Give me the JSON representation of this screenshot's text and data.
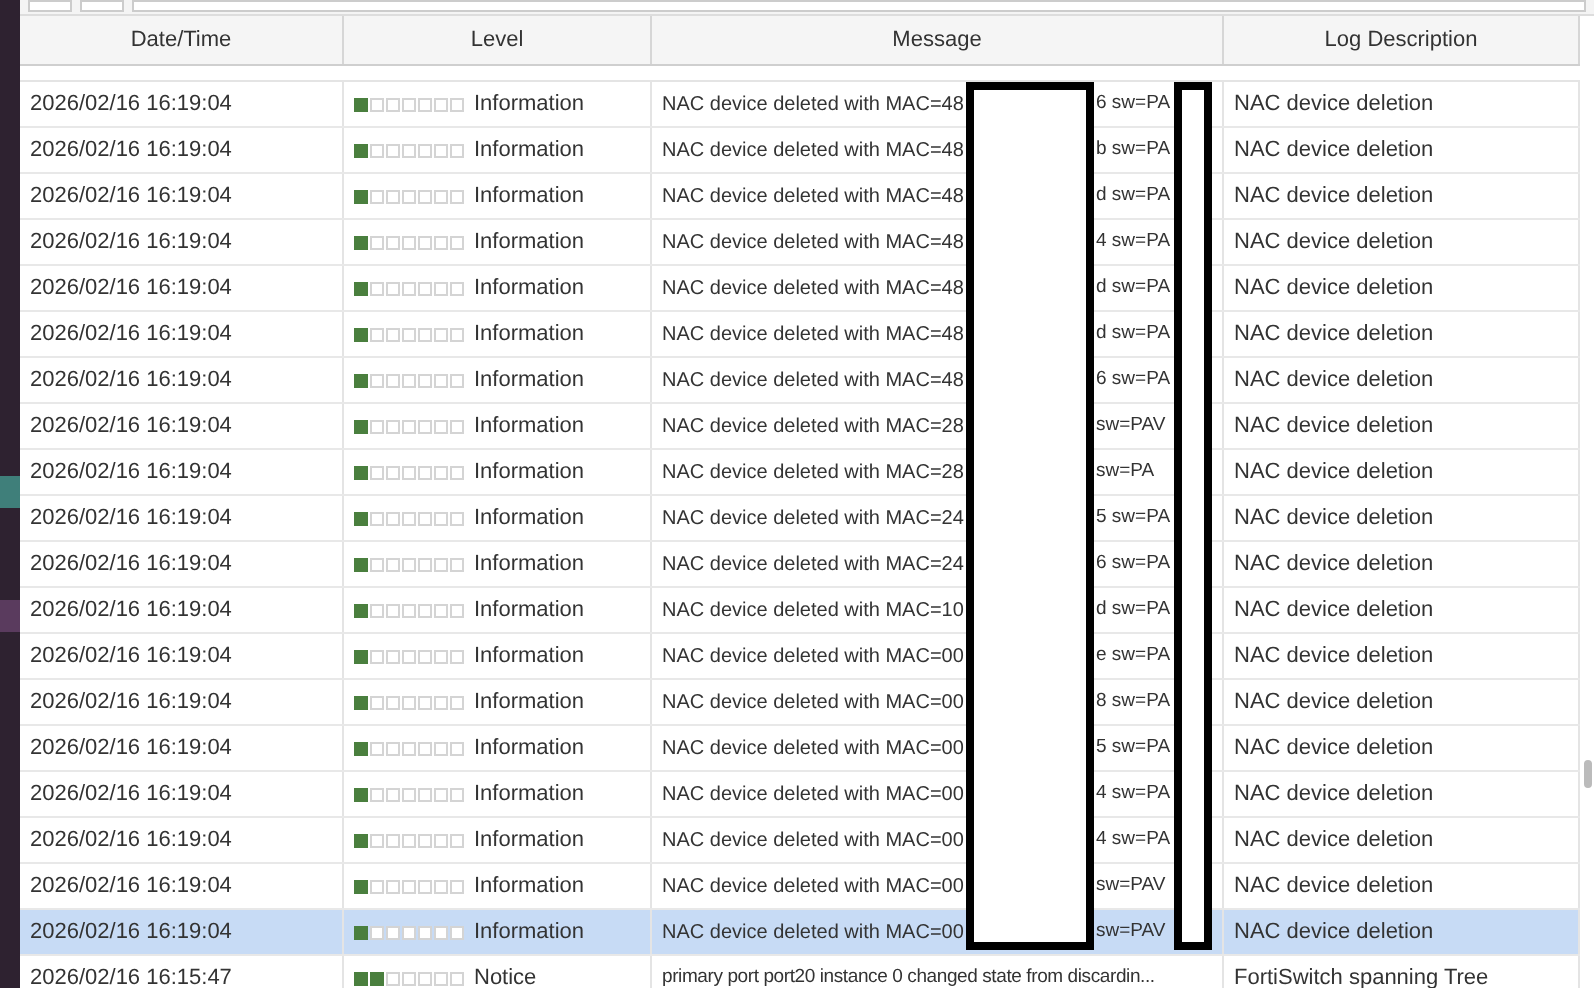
{
  "columns": [
    "Date/Time",
    "Level",
    "Message",
    "Log Description"
  ],
  "rows": [
    {
      "datetime": "2026/02/16 16:19:04",
      "level": 0.14,
      "level_text": "Information",
      "message": "NAC device deleted with MAC=48",
      "message_tail": "6 sw=PA",
      "description": "NAC device deletion",
      "selected": false
    },
    {
      "datetime": "2026/02/16 16:19:04",
      "level": 0.14,
      "level_text": "Information",
      "message": "NAC device deleted with MAC=48",
      "message_tail": "b sw=PA",
      "description": "NAC device deletion",
      "selected": false
    },
    {
      "datetime": "2026/02/16 16:19:04",
      "level": 0.14,
      "level_text": "Information",
      "message": "NAC device deleted with MAC=48",
      "message_tail": "d sw=PA",
      "description": "NAC device deletion",
      "selected": false
    },
    {
      "datetime": "2026/02/16 16:19:04",
      "level": 0.14,
      "level_text": "Information",
      "message": "NAC device deleted with MAC=48",
      "message_tail": "4 sw=PA",
      "description": "NAC device deletion",
      "selected": false
    },
    {
      "datetime": "2026/02/16 16:19:04",
      "level": 0.14,
      "level_text": "Information",
      "message": "NAC device deleted with MAC=48",
      "message_tail": "d sw=PA",
      "description": "NAC device deletion",
      "selected": false
    },
    {
      "datetime": "2026/02/16 16:19:04",
      "level": 0.14,
      "level_text": "Information",
      "message": "NAC device deleted with MAC=48",
      "message_tail": "d sw=PA",
      "description": "NAC device deletion",
      "selected": false
    },
    {
      "datetime": "2026/02/16 16:19:04",
      "level": 0.14,
      "level_text": "Information",
      "message": "NAC device deleted with MAC=48",
      "message_tail": "6 sw=PA",
      "description": "NAC device deletion",
      "selected": false
    },
    {
      "datetime": "2026/02/16 16:19:04",
      "level": 0.14,
      "level_text": "Information",
      "message": "NAC device deleted with MAC=28",
      "message_tail": "sw=PAV",
      "description": "NAC device deletion",
      "selected": false
    },
    {
      "datetime": "2026/02/16 16:19:04",
      "level": 0.14,
      "level_text": "Information",
      "message": "NAC device deleted with MAC=28",
      "message_tail": "sw=PA",
      "description": "NAC device deletion",
      "selected": false
    },
    {
      "datetime": "2026/02/16 16:19:04",
      "level": 0.14,
      "level_text": "Information",
      "message": "NAC device deleted with MAC=24",
      "message_tail": "5 sw=PA",
      "description": "NAC device deletion",
      "selected": false
    },
    {
      "datetime": "2026/02/16 16:19:04",
      "level": 0.14,
      "level_text": "Information",
      "message": "NAC device deleted with MAC=24",
      "message_tail": "6 sw=PA",
      "description": "NAC device deletion",
      "selected": false
    },
    {
      "datetime": "2026/02/16 16:19:04",
      "level": 0.14,
      "level_text": "Information",
      "message": "NAC device deleted with MAC=10",
      "message_tail": "d sw=PA",
      "description": "NAC device deletion",
      "selected": false
    },
    {
      "datetime": "2026/02/16 16:19:04",
      "level": 0.14,
      "level_text": "Information",
      "message": "NAC device deleted with MAC=00",
      "message_tail": "e sw=PA",
      "description": "NAC device deletion",
      "selected": false
    },
    {
      "datetime": "2026/02/16 16:19:04",
      "level": 0.14,
      "level_text": "Information",
      "message": "NAC device deleted with MAC=00",
      "message_tail": "8 sw=PA",
      "description": "NAC device deletion",
      "selected": false
    },
    {
      "datetime": "2026/02/16 16:19:04",
      "level": 0.14,
      "level_text": "Information",
      "message": "NAC device deleted with MAC=00",
      "message_tail": "5 sw=PA",
      "description": "NAC device deletion",
      "selected": false
    },
    {
      "datetime": "2026/02/16 16:19:04",
      "level": 0.14,
      "level_text": "Information",
      "message": "NAC device deleted with MAC=00",
      "message_tail": "4 sw=PA",
      "description": "NAC device deletion",
      "selected": false
    },
    {
      "datetime": "2026/02/16 16:19:04",
      "level": 0.14,
      "level_text": "Information",
      "message": "NAC device deleted with MAC=00",
      "message_tail": "4 sw=PA",
      "description": "NAC device deletion",
      "selected": false
    },
    {
      "datetime": "2026/02/16 16:19:04",
      "level": 0.14,
      "level_text": "Information",
      "message": "NAC device deleted with MAC=00",
      "message_tail": "sw=PAV",
      "description": "NAC device deletion",
      "selected": false
    },
    {
      "datetime": "2026/02/16 16:19:04",
      "level": 0.14,
      "level_text": "Information",
      "message": "NAC device deleted with MAC=00",
      "message_tail": "sw=PAV",
      "description": "NAC device deletion",
      "selected": true
    },
    {
      "datetime": "2026/02/16 16:15:47",
      "level": 0.29,
      "level_text": "Notice",
      "message": "primary port port20 instance 0 changed state from discardin...",
      "description": "FortiSwitch spanning Tree",
      "selected": false
    }
  ]
}
